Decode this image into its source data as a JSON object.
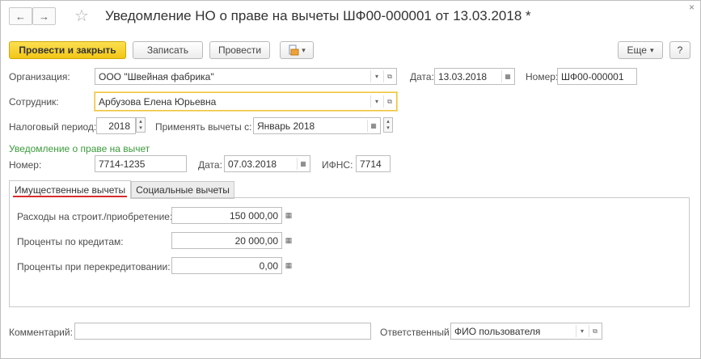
{
  "window": {
    "title": "Уведомление НО о праве на вычеты ШФ00-000001 от 13.03.2018 *",
    "close_glyph": "×",
    "back_glyph": "←",
    "forward_glyph": "→",
    "star_glyph": "☆"
  },
  "toolbar": {
    "post_close_label": "Провести и закрыть",
    "save_label": "Записать",
    "post_label": "Провести",
    "more_label": "Еще",
    "help_label": "?",
    "dropdown_glyph": "▾"
  },
  "form": {
    "organization_label": "Организация:",
    "organization_value": "ООО \"Швейная фабрика\"",
    "date_label": "Дата:",
    "date_value": "13.03.2018",
    "number_label": "Номер:",
    "number_value": "ШФ00-000001",
    "employee_label": "Сотрудник:",
    "employee_value": "Арбузова Елена Юрьевна",
    "tax_period_label": "Налоговый период:",
    "tax_period_value": "2018",
    "apply_from_label": "Применять вычеты с:",
    "apply_from_value": "Январь 2018"
  },
  "notice": {
    "section_title": "Уведомление о праве на вычет",
    "number_label": "Номер:",
    "number_value": "7714-1235",
    "date_label": "Дата:",
    "date_value": "07.03.2018",
    "ifns_label": "ИФНС:",
    "ifns_value": "7714"
  },
  "tabs": [
    {
      "label": "Имущественные вычеты",
      "active": true
    },
    {
      "label": "Социальные вычеты",
      "active": false
    }
  ],
  "deductions": [
    {
      "label": "Расходы на строит./приобретение:",
      "value": "150 000,00"
    },
    {
      "label": "Проценты по кредитам:",
      "value": "20 000,00"
    },
    {
      "label": "Проценты при перекредитовании:",
      "value": "0,00"
    }
  ],
  "footer": {
    "comment_label": "Комментарий:",
    "comment_value": "",
    "responsible_label": "Ответственный:",
    "responsible_value": "ФИО пользователя"
  },
  "colors": {
    "accent": "#f2c618",
    "section_green": "#3a9b3a",
    "tab_underline": "#d62b2b"
  }
}
